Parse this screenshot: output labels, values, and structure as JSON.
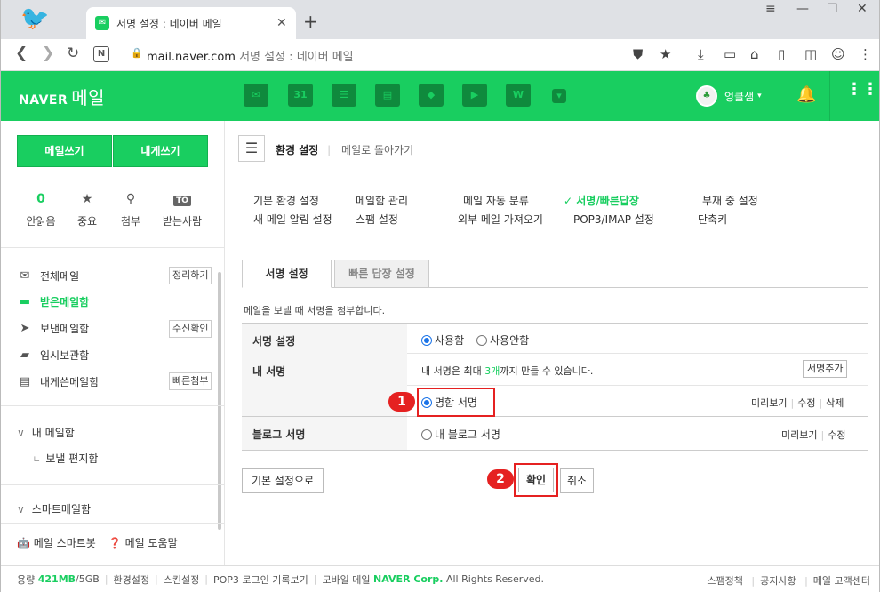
{
  "browser": {
    "tab_title": "서명 설정 : 네이버 메일",
    "url_domain": "mail.naver.com",
    "url_page_title": "서명 설정 : 네이버 메일"
  },
  "header": {
    "logo_brand": "NAVER",
    "logo_product": "메일",
    "user_name": "엉클샘",
    "app_icons": [
      "mail-app-icon",
      "calendar-app-icon",
      "list-app-icon",
      "contacts-app-icon",
      "cube-app-icon",
      "media-app-icon",
      "home-app-icon",
      "more-apps-icon"
    ],
    "calendar_day": "31"
  },
  "sidebar": {
    "write_mail": "메일쓰기",
    "write_self": "내게쓰기",
    "quick": [
      {
        "label": "안읽음",
        "value": "0"
      },
      {
        "label": "중요",
        "value": ""
      },
      {
        "label": "첨부",
        "value": ""
      },
      {
        "label": "받는사람",
        "value": "TO"
      }
    ],
    "folders": [
      {
        "label": "전체메일",
        "button": "정리하기"
      },
      {
        "label": "받은메일함",
        "button": ""
      },
      {
        "label": "보낸메일함",
        "button": "수신확인"
      },
      {
        "label": "임시보관함",
        "button": ""
      },
      {
        "label": "내게쓴메일함",
        "button": "빠른첨부"
      }
    ],
    "my_mailbox": "내 메일함",
    "sub_folder": "보낼 편지함",
    "smart_mailbox": "스마트메일함",
    "smartbot": "메일 스마트봇",
    "help": "메일 도움말"
  },
  "main": {
    "settings_title": "환경 설정",
    "back_link": "메일로 돌아가기",
    "top_links": [
      {
        "label": "기본 환경 설정",
        "active": false
      },
      {
        "label": "메일함 관리",
        "active": false
      },
      {
        "label": "메일 자동 분류",
        "active": false
      },
      {
        "label": "✓ 서명/빠른답장",
        "active": true
      },
      {
        "label": "부재 중 설정",
        "active": false
      },
      {
        "label": "새 메일 알림 설정",
        "active": false
      },
      {
        "label": "스팸 설정",
        "active": false
      },
      {
        "label": "외부 메일 가져오기",
        "active": false
      },
      {
        "label": "POP3/IMAP 설정",
        "active": false
      },
      {
        "label": "단축키",
        "active": false
      }
    ],
    "tab_signature": "서명 설정",
    "tab_quick_reply": "빠른 답장 설정",
    "description": "메일을 보낼 때 서명을 첨부합니다.",
    "row_signature_setting": "서명 설정",
    "opt_use": "사용함",
    "opt_not_use": "사용안함",
    "row_my_signature": "내 서명",
    "signature_limit_prefix": "내 서명은 최대 ",
    "signature_limit_count": "3개",
    "signature_limit_suffix": "까지 만들 수 있습니다.",
    "add_signature": "서명추가",
    "business_card_signature": "명함 서명",
    "preview": "미리보기",
    "edit": "수정",
    "delete": "삭제",
    "row_blog_signature": "블로그 서명",
    "my_blog_signature": "내 블로그 서명",
    "reset_default": "기본 설정으로",
    "confirm": "확인",
    "cancel": "취소",
    "step1": "1",
    "step2": "2"
  },
  "footer": {
    "usage_label": "용량",
    "usage_value": "421MB",
    "usage_total": "/5GB",
    "links": [
      "환경설정",
      "스킨설정",
      "POP3 로그인 기록보기",
      "모바일 메일"
    ],
    "copyright_brand": "NAVER Corp.",
    "copyright_rest": "All Rights Reserved.",
    "right_links": [
      "스팸정책",
      "공지사항",
      "메일 고객센터"
    ]
  },
  "colors": {
    "accent": "#19ce60",
    "highlight": "#e52121",
    "radio": "#1a73e8"
  }
}
